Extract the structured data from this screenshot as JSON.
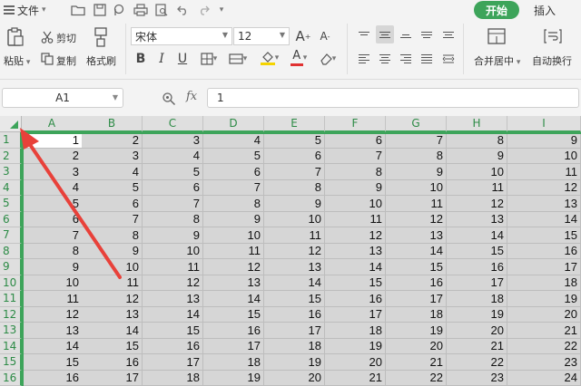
{
  "menubar": {
    "file_label": "文件",
    "tab_start": "开始",
    "tab_insert": "插入"
  },
  "ribbon": {
    "paste_label": "粘贴",
    "cut_label": "剪切",
    "copy_label": "复制",
    "format_painter_label": "格式刷",
    "font_name": "宋体",
    "font_size": "12",
    "merge_center_label": "合并居中",
    "wrap_text_label": "自动换行",
    "increase_font_label": "A",
    "decrease_font_label": "A",
    "bold_label": "B",
    "italic_label": "I",
    "underline_label": "U",
    "font_color_label": "A",
    "font_color": "#e03131",
    "fill_color": "#f5d400"
  },
  "formula_bar": {
    "name_box": "A1",
    "fx_label": "fx",
    "formula_value": "1"
  },
  "sheet": {
    "columns": [
      "A",
      "B",
      "C",
      "D",
      "E",
      "F",
      "G",
      "H",
      "I"
    ],
    "rows": [
      "1",
      "2",
      "3",
      "4",
      "5",
      "6",
      "7",
      "8",
      "9",
      "10",
      "11",
      "12",
      "13",
      "14",
      "15",
      "16"
    ],
    "cells": [
      [
        "1",
        "2",
        "3",
        "4",
        "5",
        "6",
        "7",
        "8",
        "9"
      ],
      [
        "2",
        "3",
        "4",
        "5",
        "6",
        "7",
        "8",
        "9",
        "10"
      ],
      [
        "3",
        "4",
        "5",
        "6",
        "7",
        "8",
        "9",
        "10",
        "11"
      ],
      [
        "4",
        "5",
        "6",
        "7",
        "8",
        "9",
        "10",
        "11",
        "12"
      ],
      [
        "5",
        "6",
        "7",
        "8",
        "9",
        "10",
        "11",
        "12",
        "13"
      ],
      [
        "6",
        "7",
        "8",
        "9",
        "10",
        "11",
        "12",
        "13",
        "14"
      ],
      [
        "7",
        "8",
        "9",
        "10",
        "11",
        "12",
        "13",
        "14",
        "15"
      ],
      [
        "8",
        "9",
        "10",
        "11",
        "12",
        "13",
        "14",
        "15",
        "16"
      ],
      [
        "9",
        "10",
        "11",
        "12",
        "13",
        "14",
        "15",
        "16",
        "17"
      ],
      [
        "10",
        "11",
        "12",
        "13",
        "14",
        "15",
        "16",
        "17",
        "18"
      ],
      [
        "11",
        "12",
        "13",
        "14",
        "15",
        "16",
        "17",
        "18",
        "19"
      ],
      [
        "12",
        "13",
        "14",
        "15",
        "16",
        "17",
        "18",
        "19",
        "20"
      ],
      [
        "13",
        "14",
        "15",
        "16",
        "17",
        "18",
        "19",
        "20",
        "21"
      ],
      [
        "14",
        "15",
        "16",
        "17",
        "18",
        "19",
        "20",
        "21",
        "22"
      ],
      [
        "15",
        "16",
        "17",
        "18",
        "19",
        "20",
        "21",
        "22",
        "23"
      ],
      [
        "16",
        "17",
        "18",
        "19",
        "20",
        "21",
        "22",
        "23",
        "24"
      ]
    ],
    "active_cell": "A1",
    "accent_color": "#3da45a",
    "annotation_arrow_color": "#e8413a"
  }
}
